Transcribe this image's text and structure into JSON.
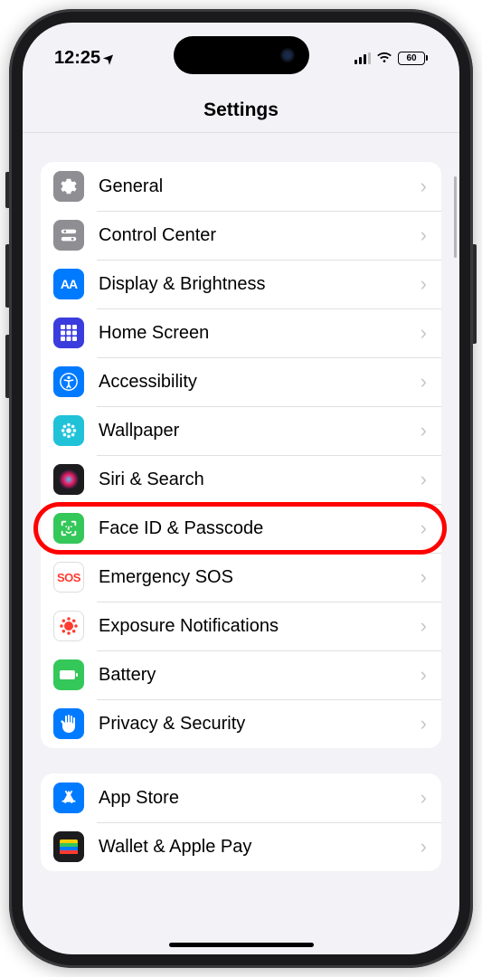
{
  "statusBar": {
    "time": "12:25",
    "location_glyph": "➤",
    "battery_pct": "60"
  },
  "header": {
    "title": "Settings"
  },
  "groups": [
    {
      "items": [
        {
          "id": "general",
          "label": "General",
          "icon": "gear",
          "bg": "#8e8e93"
        },
        {
          "id": "control-center",
          "label": "Control Center",
          "icon": "switches",
          "bg": "#8e8e93"
        },
        {
          "id": "display",
          "label": "Display & Brightness",
          "icon": "aa",
          "bg": "#007aff"
        },
        {
          "id": "home-screen",
          "label": "Home Screen",
          "icon": "grid",
          "bg": "#3a3cdd"
        },
        {
          "id": "accessibility",
          "label": "Accessibility",
          "icon": "accessibility",
          "bg": "#007aff"
        },
        {
          "id": "wallpaper",
          "label": "Wallpaper",
          "icon": "flower",
          "bg": "#20c2d8"
        },
        {
          "id": "siri",
          "label": "Siri & Search",
          "icon": "siri",
          "bg": "#1c1c1e"
        },
        {
          "id": "faceid",
          "label": "Face ID & Passcode",
          "icon": "faceid",
          "bg": "#34c759",
          "highlighted": true
        },
        {
          "id": "sos",
          "label": "Emergency SOS",
          "icon": "sos",
          "bg": "#ffffff"
        },
        {
          "id": "exposure",
          "label": "Exposure Notifications",
          "icon": "exposure",
          "bg": "#ffffff"
        },
        {
          "id": "battery",
          "label": "Battery",
          "icon": "battery",
          "bg": "#34c759"
        },
        {
          "id": "privacy",
          "label": "Privacy & Security",
          "icon": "hand",
          "bg": "#007aff"
        }
      ]
    },
    {
      "items": [
        {
          "id": "appstore",
          "label": "App Store",
          "icon": "appstore",
          "bg": "#007aff"
        },
        {
          "id": "wallet",
          "label": "Wallet & Apple Pay",
          "icon": "wallet",
          "bg": "#1c1c1e"
        }
      ]
    }
  ]
}
